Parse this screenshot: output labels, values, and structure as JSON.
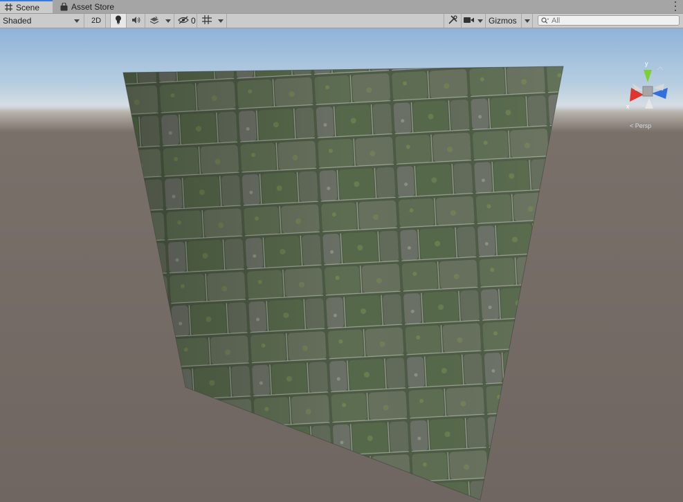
{
  "tabs": [
    {
      "label": "Scene",
      "icon": "grid-icon",
      "active": true
    },
    {
      "label": "Asset Store",
      "icon": "shopping-bag-icon",
      "active": false
    }
  ],
  "toolbar": {
    "shading_mode": "Shaded",
    "mode_2d_label": "2D",
    "hidden_count": "0",
    "gizmos_label": "Gizmos",
    "search_placeholder": "All"
  },
  "gizmo": {
    "y_label": "y",
    "x_label": "x",
    "projection_label": "< Persp"
  },
  "colors": {
    "active_tab_accent": "#3a79d4",
    "gizmo_x": "#e0352b",
    "gizmo_y": "#7bd12f",
    "gizmo_z": "#2f6fe0"
  }
}
